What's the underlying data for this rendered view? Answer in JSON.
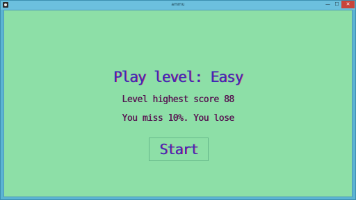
{
  "window": {
    "title": "ammu",
    "minimize_glyph": "—",
    "maximize_glyph": "☐",
    "close_glyph": "✕",
    "client_bg": "#8ddfa7",
    "frame_color": "#5bb4d3",
    "close_color": "#c9443a"
  },
  "game": {
    "title": "Play level: Easy",
    "score_line": "Level highest score 88",
    "status_line": "You miss 10%. You lose",
    "start_label": "Start",
    "title_color": "#3a2bb8",
    "text_color": "#4a1850"
  }
}
